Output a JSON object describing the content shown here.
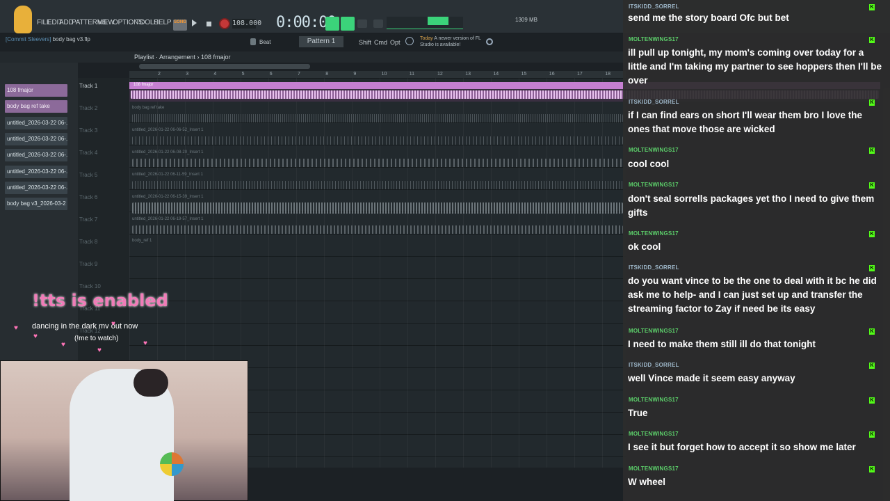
{
  "menu": [
    "FILE",
    "EDIT",
    "ADD",
    "PATTERNS",
    "VIEW",
    "OPTIONS",
    "TOOLS",
    "HELP"
  ],
  "transport": {
    "song_label": "SONG",
    "tempo": "108.000",
    "timer": "0:00:00",
    "memory": "1309 MB"
  },
  "file": {
    "prefix": "[Commit Sleevers]",
    "name": "body bag v3.flp"
  },
  "pattern": "Pattern 1",
  "snap": "Beat",
  "toolbar_labels": [
    "Shift",
    "Cmd",
    "Opt"
  ],
  "news": {
    "when": "Today",
    "text": "A newer version of FL Studio is available!"
  },
  "breadcrumb": "Playlist · Arrangement › 108 fmajor",
  "browser": {
    "clips": [
      "108 fmajor",
      "body bag ref take",
      "untitled_2026-03-22 06-...",
      "untitled_2026-03-22 06-...",
      "untitled_2026-03-22 06-...",
      "untitled_2026-03-22 06-...",
      "untitled_2026-03-22 06-...",
      "body bag v3_2026-03-2"
    ]
  },
  "ruler": [
    "2",
    "3",
    "4",
    "5",
    "6",
    "7",
    "8",
    "9",
    "10",
    "11",
    "12",
    "13",
    "14",
    "15",
    "16",
    "17",
    "18"
  ],
  "tracks": [
    "Track 1",
    "Track 2",
    "Track 3",
    "Track 4",
    "Track 5",
    "Track 6",
    "Track 7",
    "Track 8",
    "Track 9",
    "Track 10",
    "Track 11",
    "Track 12"
  ],
  "clip_labels": [
    "108 fmajor",
    "body bag ref take",
    "untitled_2026-01-22 06-06-52_Insert 1",
    "untitled_2026-01-22 06-08-20_Insert 1",
    "untitled_2026-01-22 06-11-59_Insert 1",
    "untitled_2026-01-22 06-15-39_Insert 1",
    "untitled_2026-01-22 06-19-57_Insert 1",
    "body_ref 1"
  ],
  "overlay": {
    "tts": "!tts is enabled",
    "line1": "dancing in the dark mv out now",
    "line2": "(!me to watch)"
  },
  "chat": [
    {
      "user": "ITSKIDD_SORREL",
      "text": "send me the story board Ofc but bet"
    },
    {
      "user": "MOLTENWINGS17",
      "text": "ill pull up tonight, my mom's coming over today for a little and I'm taking my partner to see hoppers then I'll be over"
    },
    {
      "user": "ITSKIDD_SORREL",
      "text": "if I can find ears on short I'll wear them bro I love the ones that move those are wicked"
    },
    {
      "user": "MOLTENWINGS17",
      "text": "cool cool"
    },
    {
      "user": "MOLTENWINGS17",
      "text": "don't seal sorrells packages yet tho I need to give them gifts"
    },
    {
      "user": "MOLTENWINGS17",
      "text": "ok cool"
    },
    {
      "user": "ITSKIDD_SORREL",
      "text": "do you want vince to be the one to deal with it bc he did ask me to help- and I can just set up and transfer the streaming factor to Zay if need be its easy"
    },
    {
      "user": "MOLTENWINGS17",
      "text": "I need to make them still ill do that tonight"
    },
    {
      "user": "ITSKIDD_SORREL",
      "text": "well Vince made it seem easy anyway"
    },
    {
      "user": "MOLTENWINGS17",
      "text": "True"
    },
    {
      "user": "MOLTENWINGS17",
      "text": "I see it but forget how to accept it so show me later"
    },
    {
      "user": "MOLTENWINGS17",
      "text": "W wheel"
    }
  ],
  "colors": {
    "accent_green": "#3bd37a",
    "clip_purple": "#8c6a9a",
    "tts_pink": "#f07cb8",
    "kick_green": "#53fc18"
  }
}
